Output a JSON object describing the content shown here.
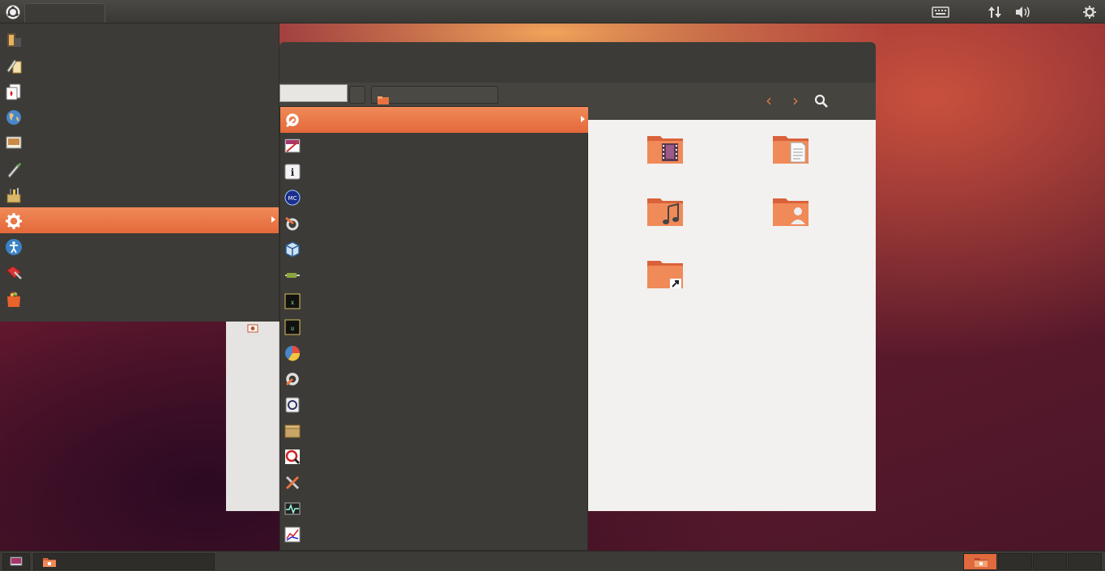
{
  "top_panel": {
    "dash_icon": "ubuntu-logo-icon",
    "tray": [
      "keyboard-icon",
      "network-icon",
      "volume-icon",
      "session-gear-icon"
    ]
  },
  "app_menu": {
    "items": [
      {
        "icon": "multimedia-icon"
      },
      {
        "icon": "office-icon"
      },
      {
        "icon": "games-cards-icon"
      },
      {
        "icon": "internet-globe-icon"
      },
      {
        "icon": "graphics-icon"
      },
      {
        "icon": "education-icon"
      },
      {
        "icon": "accessories-icon"
      },
      {
        "icon": "system-tools-icon",
        "active": true
      },
      {
        "icon": "universal-access-icon"
      },
      {
        "icon": "programming-icon"
      },
      {
        "icon": "software-center-icon"
      }
    ]
  },
  "sub_menu": {
    "items": [
      {
        "icon": "preferences-tools-icon",
        "active": true
      },
      {
        "icon": "screenshot-viewer-icon"
      },
      {
        "icon": "info-icon"
      },
      {
        "icon": "mc-terminal-icon"
      },
      {
        "icon": "gear-brush-icon"
      },
      {
        "icon": "virtualbox-icon"
      },
      {
        "icon": "cable-icon"
      },
      {
        "icon": "terminal-xterm-icon"
      },
      {
        "icon": "terminal-uxterm-icon"
      },
      {
        "icon": "disk-usage-pie-icon"
      },
      {
        "icon": "settings-tools-icon"
      },
      {
        "icon": "disk-utility-icon"
      },
      {
        "icon": "archive-box-icon"
      },
      {
        "icon": "search-magnifier-icon"
      },
      {
        "icon": "wrench-screwdriver-icon"
      },
      {
        "icon": "system-monitor-icon"
      },
      {
        "icon": "graph-chart-icon"
      }
    ]
  },
  "file_manager": {
    "folders": [
      {
        "icon": "videos-folder-icon"
      },
      {
        "icon": "documents-folder-icon"
      },
      {
        "icon": "music-folder-icon"
      },
      {
        "icon": "public-folder-icon"
      },
      {
        "icon": "shortcut-folder-icon"
      }
    ]
  },
  "colors": {
    "accent": "#e9723f",
    "panel": "#3c3b37",
    "content_bg": "#f2f1f0"
  }
}
